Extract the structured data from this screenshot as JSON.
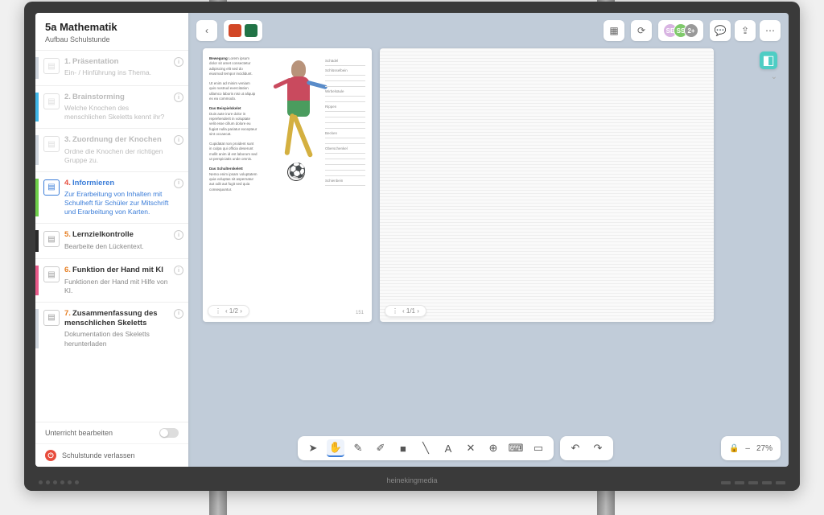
{
  "monitor_brand": "heinekingmedia",
  "sidebar": {
    "title": "5a Mathematik",
    "subtitle": "Aufbau Schulstunde",
    "items": [
      {
        "num": "1.",
        "title": "Präsentation",
        "desc": "Ein- / Hinführung ins Thema.",
        "color": "#d0d6de",
        "dimmed": true
      },
      {
        "num": "2.",
        "title": "Brainstorming",
        "desc": "Welche Knochen des menschlichen Skeletts kennt ihr?",
        "color": "#3fb6e8",
        "dimmed": true
      },
      {
        "num": "3.",
        "title": "Zuordnung der Knochen",
        "desc": "Ordne die Knochen der richtigen Gruppe zu.",
        "color": "#d0d6de",
        "dimmed": true
      },
      {
        "num": "4.",
        "title": "Informieren",
        "desc": "Zur Erarbeitung von Inhalten mit Schulheft für Schüler zur Mitschrift und Erarbeitung von Karten.",
        "color": "#6fcf4a",
        "active": true
      },
      {
        "num": "5.",
        "title": "Lernzielkontrolle",
        "desc": "Bearbeite den Lückentext.",
        "color": "#2a2a2a"
      },
      {
        "num": "6.",
        "title": "Funktion der Hand mit KI",
        "desc": "Funktionen der Hand mit Hilfe von KI.",
        "color": "#e85a8a"
      },
      {
        "num": "7.",
        "title": "Zusammenfassung des menschlichen Skeletts",
        "desc": "Dokumentation des Skeletts herunterladen",
        "color": "#d0d6de"
      }
    ],
    "edit_label": "Unterricht bearbeiten",
    "leave_label": "Schulstunde verlassen"
  },
  "topbar": {
    "back": "‹",
    "apps": [
      {
        "name": "powerpoint",
        "color": "#d24726"
      },
      {
        "name": "excel",
        "color": "#217346"
      }
    ],
    "participants_extra": "2+",
    "avatars": [
      {
        "bg": "#d8b4e2",
        "initials": "SE"
      },
      {
        "bg": "#7fc96b",
        "initials": "SS"
      }
    ]
  },
  "pages": {
    "left_nav": "‹ 1/2 ›",
    "right_nav": "‹ 1/1 ›",
    "left_pagenum": "151",
    "skeleton_heading": "Bewegung",
    "label_samples": [
      "Schädel",
      "Schlüsselbein",
      "",
      "",
      "Wirbelsäule",
      "",
      "Rippen",
      "",
      "",
      "",
      "Becken",
      "",
      "Oberschenkel",
      "",
      "",
      "",
      "",
      "Schienbein"
    ]
  },
  "tools": {
    "items": [
      "pointer",
      "hand",
      "pen",
      "highlighter",
      "shape",
      "line",
      "text",
      "eraser",
      "compass",
      "keyboard",
      "image"
    ],
    "undo": "↶",
    "redo": "↷"
  },
  "zoom": {
    "lock": "🔒",
    "minus": "–",
    "level": "27%"
  }
}
